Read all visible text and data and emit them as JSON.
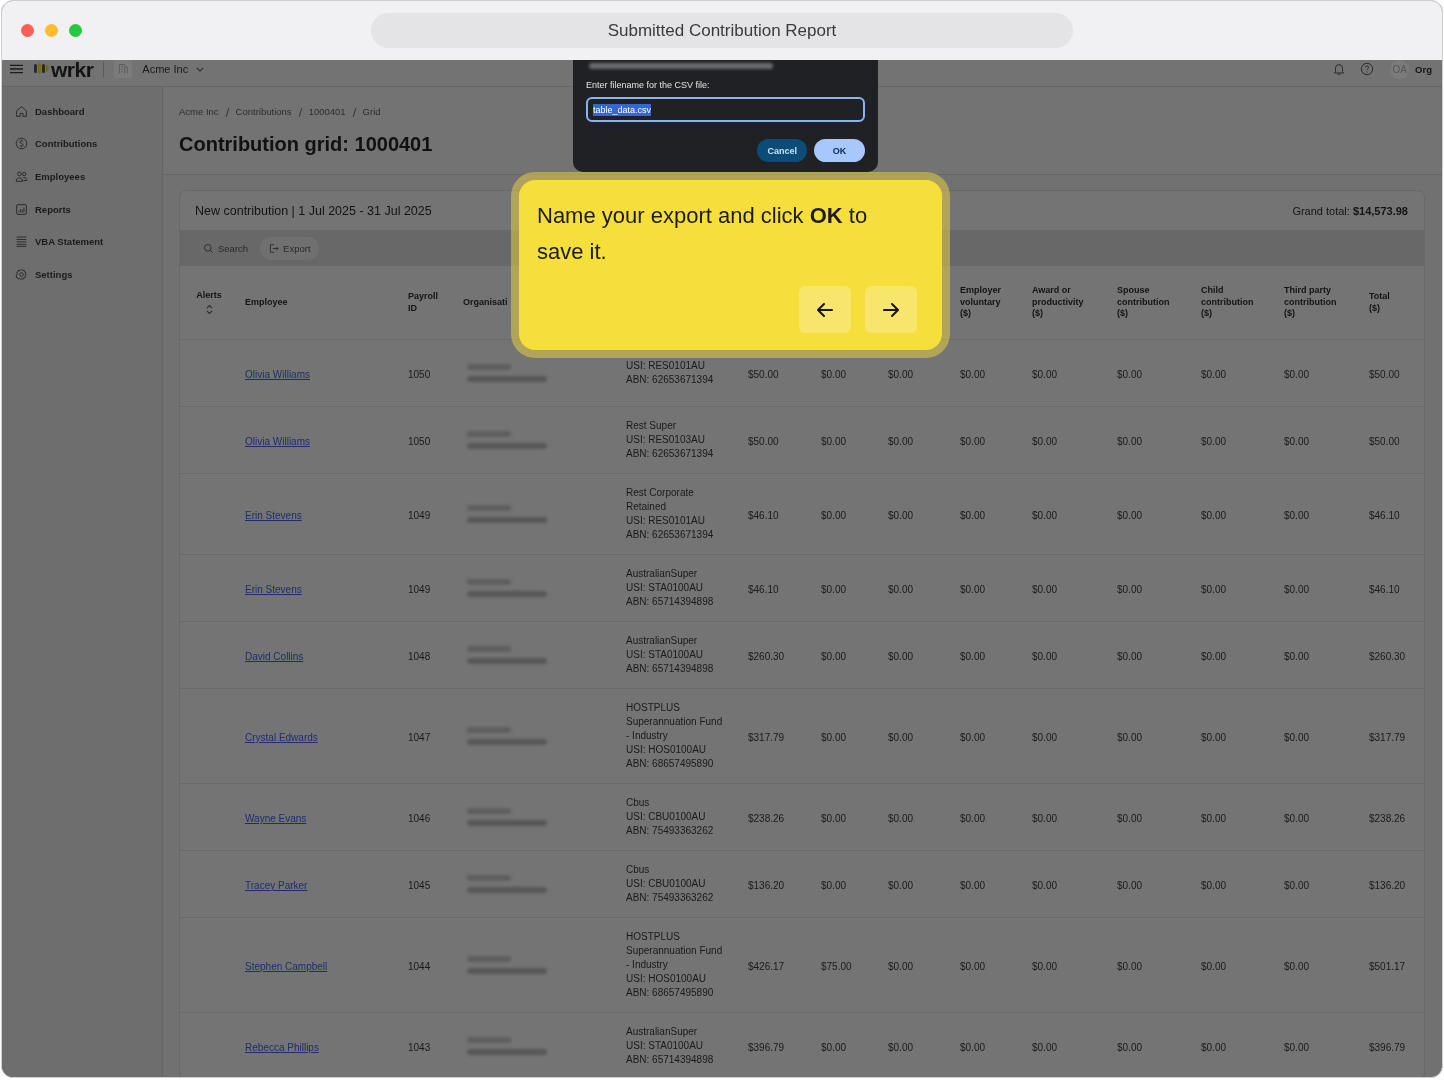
{
  "window": {
    "title": "Submitted Contribution Report"
  },
  "app_header": {
    "logo": "wrkr",
    "organization": "Acme Inc",
    "avatar_initials": "OA",
    "account_label": "Org"
  },
  "export_dialog": {
    "label": "Enter filename for the CSV file:",
    "value": "table_data.csv",
    "value_selected": true,
    "buttons": [
      {
        "label": "Cancel",
        "kind": "secondary"
      },
      {
        "label": "OK",
        "kind": "primary"
      }
    ]
  },
  "tour_callout": {
    "message": "Name your export and click **OK** to save it.",
    "buttons": [
      {
        "kind": "back"
      },
      {
        "kind": "next"
      }
    ]
  },
  "sidebar": {
    "items": [
      {
        "label": "Dashboard"
      },
      {
        "label": "Contributions"
      },
      {
        "label": "Employees"
      },
      {
        "label": "Reports"
      },
      {
        "label": "VBA Statement"
      },
      {
        "label": "Settings"
      }
    ]
  },
  "breadcrumb": [
    "Acme Inc",
    "Contributions",
    "1000401",
    "Grid"
  ],
  "page_title": "Contribution grid: 1000401",
  "contribution_card": {
    "heading": "New contribution | 1 Jul 2025 - 31 Jul 2025",
    "grand_total": "Grand total: **$14,573.98**",
    "toolbar": [
      {
        "label": "Search",
        "kind": "search"
      },
      {
        "label": "Export",
        "kind": "export"
      }
    ],
    "table": {
      "columns_left": [
        {
          "label": "Alerts",
          "sortable": true
        },
        {
          "label": "Employee",
          "sortable": false
        },
        {
          "label": "Payroll ID",
          "sortable": false
        },
        {
          "label": "Organisati",
          "sortable": false
        }
      ],
      "columns_right": [
        {
          "label": "Employer voluntary ($)",
          "sortable": false
        },
        {
          "label": "Award or productivity ($)",
          "sortable": false
        },
        {
          "label": "Spouse contribution ($)",
          "sortable": false
        },
        {
          "label": "Child contribution ($)",
          "sortable": false
        },
        {
          "label": "Third party contribution ($)",
          "sortable": false
        },
        {
          "label": "Total ($)",
          "sortable": false
        }
      ],
      "rows": [
        {
          "employee": "Olivia Williams",
          "payroll_id": "1050",
          "fund": [
            "USI: RES0101AU",
            "ABN: 62653671394"
          ],
          "amounts": [
            "$50.00",
            "$0.00",
            "$0.00",
            "$0.00",
            "$0.00",
            "$0.00",
            "$0.00",
            "$0.00",
            "$50.00"
          ]
        },
        {
          "employee": "Olivia Williams",
          "payroll_id": "1050",
          "fund": [
            "Rest Super",
            "USI: RES0103AU",
            "ABN: 62653671394"
          ],
          "amounts": [
            "$50.00",
            "$0.00",
            "$0.00",
            "$0.00",
            "$0.00",
            "$0.00",
            "$0.00",
            "$0.00",
            "$50.00"
          ]
        },
        {
          "employee": "Erin Stevens",
          "payroll_id": "1049",
          "fund": [
            "Rest Corporate Retained",
            "USI: RES0101AU",
            "ABN: 62653671394"
          ],
          "amounts": [
            "$46.10",
            "$0.00",
            "$0.00",
            "$0.00",
            "$0.00",
            "$0.00",
            "$0.00",
            "$0.00",
            "$46.10"
          ]
        },
        {
          "employee": "Erin Stevens",
          "payroll_id": "1049",
          "fund": [
            "AustralianSuper",
            "USI: STA0100AU",
            "ABN: 65714394898"
          ],
          "amounts": [
            "$46.10",
            "$0.00",
            "$0.00",
            "$0.00",
            "$0.00",
            "$0.00",
            "$0.00",
            "$0.00",
            "$46.10"
          ]
        },
        {
          "employee": "David Collins",
          "payroll_id": "1048",
          "fund": [
            "AustralianSuper",
            "USI: STA0100AU",
            "ABN: 65714394898"
          ],
          "amounts": [
            "$260.30",
            "$0.00",
            "$0.00",
            "$0.00",
            "$0.00",
            "$0.00",
            "$0.00",
            "$0.00",
            "$260.30"
          ]
        },
        {
          "employee": "Crystal Edwards",
          "payroll_id": "1047",
          "fund": [
            "HOSTPLUS Superannuation Fund - Industry",
            "USI: HOS0100AU",
            "ABN: 68657495890"
          ],
          "amounts": [
            "$317.79",
            "$0.00",
            "$0.00",
            "$0.00",
            "$0.00",
            "$0.00",
            "$0.00",
            "$0.00",
            "$317.79"
          ]
        },
        {
          "employee": "Wayne Evans",
          "payroll_id": "1046",
          "fund": [
            "Cbus",
            "USI: CBU0100AU",
            "ABN: 75493363262"
          ],
          "amounts": [
            "$238.26",
            "$0.00",
            "$0.00",
            "$0.00",
            "$0.00",
            "$0.00",
            "$0.00",
            "$0.00",
            "$238.26"
          ]
        },
        {
          "employee": "Tracey Parker",
          "payroll_id": "1045",
          "fund": [
            "Cbus",
            "USI: CBU0100AU",
            "ABN: 75493363262"
          ],
          "amounts": [
            "$136.20",
            "$0.00",
            "$0.00",
            "$0.00",
            "$0.00",
            "$0.00",
            "$0.00",
            "$0.00",
            "$136.20"
          ]
        },
        {
          "employee": "Stephen Campbell",
          "payroll_id": "1044",
          "fund": [
            "HOSTPLUS Superannuation Fund - Industry",
            "USI: HOS0100AU",
            "ABN: 68657495890"
          ],
          "amounts": [
            "$426.17",
            "$75.00",
            "$0.00",
            "$0.00",
            "$0.00",
            "$0.00",
            "$0.00",
            "$0.00",
            "$501.17"
          ]
        },
        {
          "employee": "Rebecca Phillips",
          "payroll_id": "1043",
          "fund": [
            "AustralianSuper",
            "USI: STA0100AU",
            "ABN: 65714394898"
          ],
          "amounts": [
            "$396.79",
            "$0.00",
            "$0.00",
            "$0.00",
            "$0.00",
            "$0.00",
            "$0.00",
            "$0.00",
            "$396.79"
          ]
        }
      ]
    }
  }
}
